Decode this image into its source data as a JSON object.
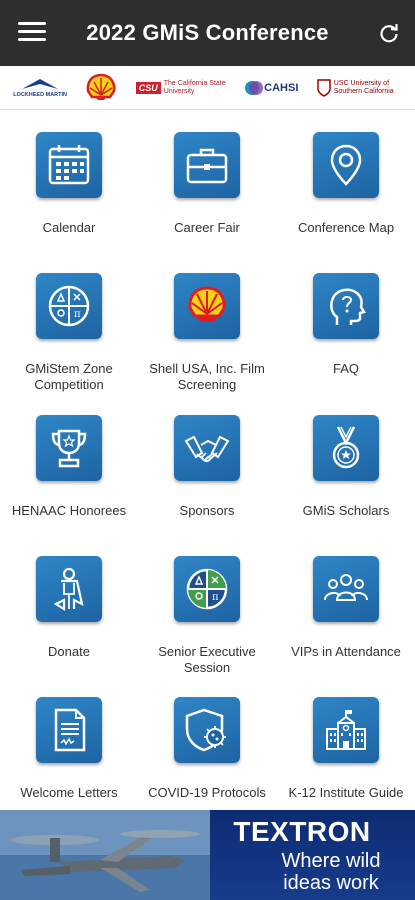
{
  "app_bar": {
    "title": "2022 GMiS Conference",
    "menu_icon": "hamburger-icon",
    "refresh_icon": "refresh-icon"
  },
  "sponsor_strip": {
    "logos": [
      {
        "name": "Lockheed Martin",
        "text": "LOCKHEED MARTIN"
      },
      {
        "name": "Shell",
        "text": ""
      },
      {
        "name": "CSU",
        "badge": "CSU",
        "text": "The California State University"
      },
      {
        "name": "CAHSI",
        "text": "CAHSI"
      },
      {
        "name": "USC",
        "text": "USC University of Southern California"
      }
    ]
  },
  "grid": {
    "tiles": [
      {
        "label": "Calendar",
        "icon": "calendar-icon"
      },
      {
        "label": "Career Fair",
        "icon": "briefcase-icon"
      },
      {
        "label": "Conference Map",
        "icon": "map-pin-icon"
      },
      {
        "label": "GMiStem Zone Competition",
        "icon": "stem-zone-icon"
      },
      {
        "label": "Shell USA, Inc. Film Screening",
        "icon": "shell-logo-icon"
      },
      {
        "label": "FAQ",
        "icon": "head-question-icon"
      },
      {
        "label": "HENAAC Honorees",
        "icon": "trophy-icon"
      },
      {
        "label": "Sponsors",
        "icon": "handshake-icon"
      },
      {
        "label": "GMiS Scholars",
        "icon": "medal-icon"
      },
      {
        "label": "Donate",
        "icon": "superhero-icon"
      },
      {
        "label": "Senior Executive Session",
        "icon": "stem-zone-icon"
      },
      {
        "label": "VIPs in Attendance",
        "icon": "group-icon"
      },
      {
        "label": "Welcome Letters",
        "icon": "document-icon"
      },
      {
        "label": "COVID-19 Protocols",
        "icon": "virus-shield-icon"
      },
      {
        "label": "K-12 Institute Guide",
        "icon": "school-building-icon"
      }
    ]
  },
  "banner": {
    "brand": "TEXTRON",
    "tagline": "Where wild ideas work",
    "image_icon": "aircraft-icon"
  },
  "colors": {
    "topbar": "#2e2e2e",
    "tile_blue": "#2378b8",
    "banner_blue": "#0d2b72"
  }
}
